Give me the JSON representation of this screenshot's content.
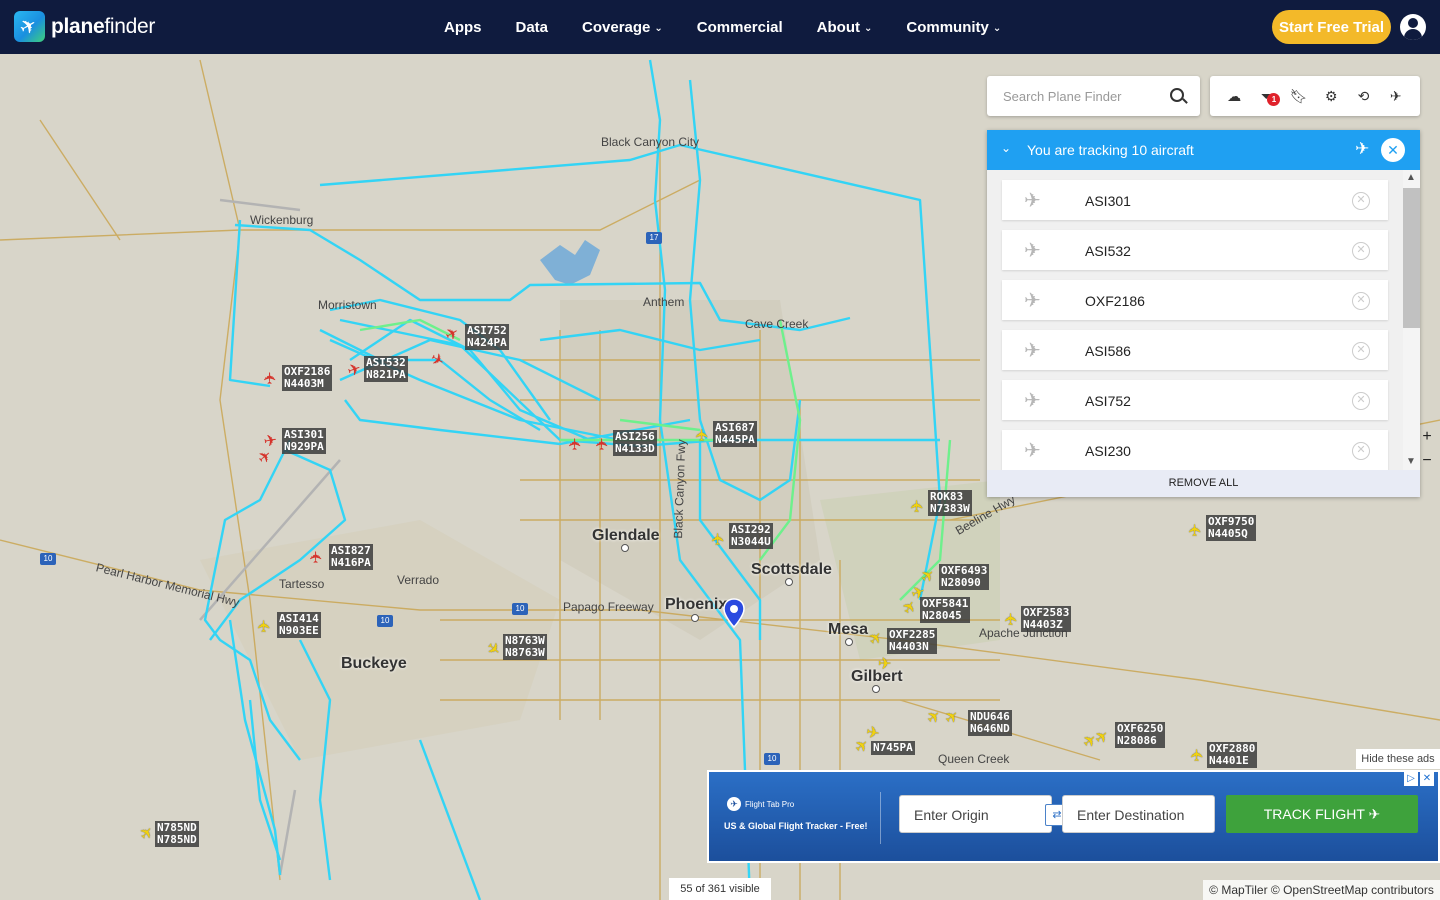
{
  "header": {
    "logo_bold": "plane",
    "logo_light": "finder",
    "nav": [
      {
        "label": "Apps",
        "has_menu": false
      },
      {
        "label": "Data",
        "has_menu": false
      },
      {
        "label": "Coverage",
        "has_menu": true
      },
      {
        "label": "Commercial",
        "has_menu": false
      },
      {
        "label": "About",
        "has_menu": true
      },
      {
        "label": "Community",
        "has_menu": true
      }
    ],
    "cta_label": "Start Free Trial"
  },
  "search": {
    "placeholder": "Search Plane Finder"
  },
  "toolbar": {
    "filter_badge": "1",
    "icons": [
      "cloud-icon",
      "filter-icon",
      "bookmark-icon",
      "settings-icon",
      "history-icon",
      "aircraft-settings-icon"
    ]
  },
  "tracking": {
    "title": "You are tracking 10 aircraft",
    "items": [
      "ASI301",
      "ASI532",
      "OXF2186",
      "ASI586",
      "ASI752",
      "ASI230"
    ],
    "remove_all": "REMOVE ALL"
  },
  "map": {
    "places": [
      {
        "name": "Black Canyon City",
        "type": "place"
      },
      {
        "name": "Wickenburg",
        "type": "place"
      },
      {
        "name": "Morristown",
        "type": "place"
      },
      {
        "name": "Anthem",
        "type": "place"
      },
      {
        "name": "Cave Creek",
        "type": "place"
      },
      {
        "name": "Glendale",
        "type": "city"
      },
      {
        "name": "Scottsdale",
        "type": "city"
      },
      {
        "name": "Phoenix",
        "type": "city"
      },
      {
        "name": "Mesa",
        "type": "city"
      },
      {
        "name": "Gilbert",
        "type": "city"
      },
      {
        "name": "Buckeye",
        "type": "city"
      },
      {
        "name": "Tartesso",
        "type": "place"
      },
      {
        "name": "Verrado",
        "type": "place"
      },
      {
        "name": "Queen Creek",
        "type": "place"
      },
      {
        "name": "Apache Junction",
        "type": "place"
      },
      {
        "name": "Papago Freeway",
        "type": "place"
      },
      {
        "name": "Pearl Harbor Memorial Hwy",
        "type": "place"
      },
      {
        "name": "Black Canyon Fwy",
        "type": "place"
      },
      {
        "name": "Beeline Hwy",
        "type": "place"
      }
    ],
    "highway_shields": [
      "10",
      "17",
      "10",
      "10",
      "10"
    ],
    "aircraft": [
      {
        "line1": "ASI752",
        "line2": "N424PA",
        "color": "red"
      },
      {
        "line1": "ASI532",
        "line2": "N821PA",
        "color": "red"
      },
      {
        "line1": "OXF2186",
        "line2": "N4403M",
        "color": "red"
      },
      {
        "line1": "ASI301",
        "line2": "N929PA",
        "color": "red"
      },
      {
        "line1": "ASI256",
        "line2": "N4133D",
        "color": "red"
      },
      {
        "line1": "ASI687",
        "line2": "N445PA",
        "color": "yellow"
      },
      {
        "line1": "ASI292",
        "line2": "N3044U",
        "color": "yellow"
      },
      {
        "line1": "ASI827",
        "line2": "N416PA",
        "color": "red"
      },
      {
        "line1": "ASI414",
        "line2": "N903EE",
        "color": "yellow"
      },
      {
        "line1": "N8763W",
        "line2": "N8763W",
        "color": "yellow"
      },
      {
        "line1": "ROK83",
        "line2": "N7383W",
        "color": "yellow"
      },
      {
        "line1": "OXF9750",
        "line2": "N4405Q",
        "color": "yellow"
      },
      {
        "line1": "OXF6493",
        "line2": "N28090",
        "color": "yellow"
      },
      {
        "line1": "OXF5841",
        "line2": "N28045",
        "color": "yellow"
      },
      {
        "line1": "OXF2583",
        "line2": "N4403Z",
        "color": "yellow"
      },
      {
        "line1": "OXF2285",
        "line2": "N4403N",
        "color": "yellow"
      },
      {
        "line1": "NDU646",
        "line2": "N646ND",
        "color": "yellow"
      },
      {
        "line1": "N745PA",
        "line2": "",
        "color": "yellow"
      },
      {
        "line1": "OXF6250",
        "line2": "N28086",
        "color": "yellow"
      },
      {
        "line1": "OXF2880",
        "line2": "N4401E",
        "color": "yellow"
      },
      {
        "line1": "N785ND",
        "line2": "N785ND",
        "color": "yellow"
      }
    ],
    "track_color": "#33d4f5"
  },
  "ad": {
    "hide_label": "Hide these ads",
    "brand": "Flight Tab Pro",
    "tagline": "US & Global Flight Tracker - Free!",
    "origin_placeholder": "Enter Origin",
    "destination_placeholder": "Enter Destination",
    "track_label": "TRACK FLIGHT"
  },
  "footer": {
    "visible_count": "55 of 361 visible",
    "attribution": "© MapTiler © OpenStreetMap contributors"
  }
}
